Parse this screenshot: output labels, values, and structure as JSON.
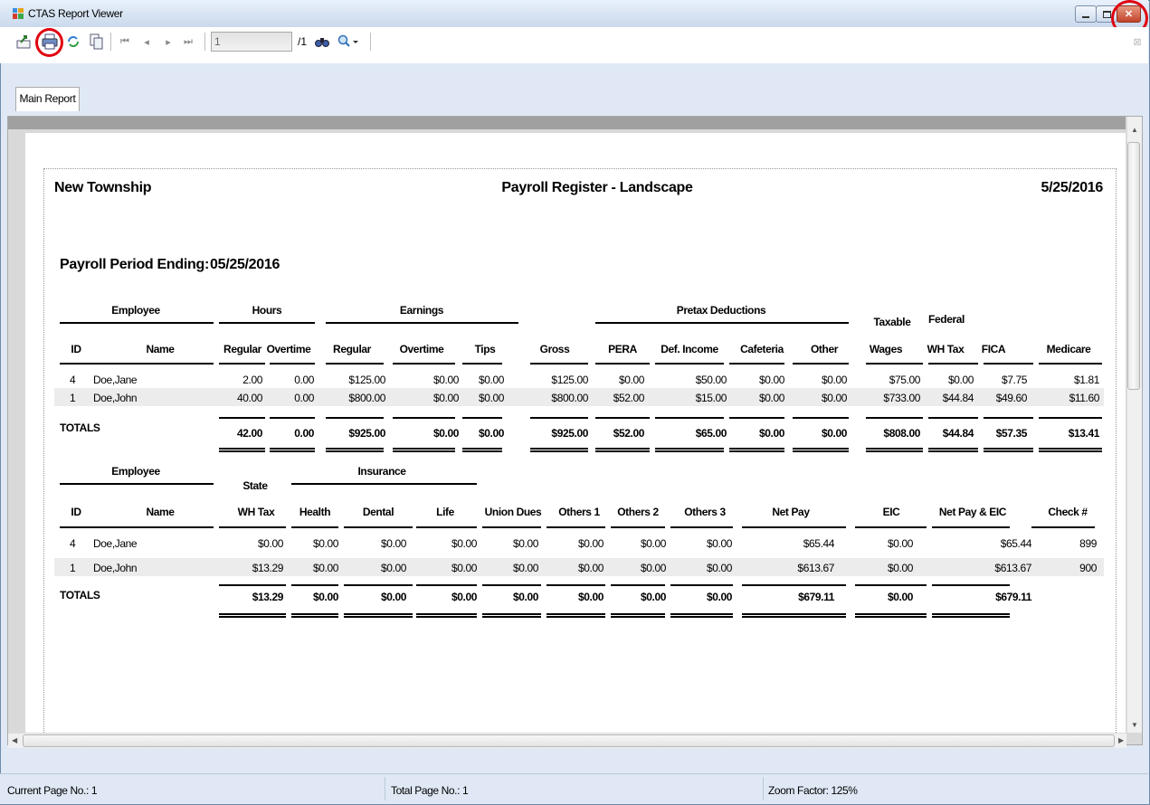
{
  "window": {
    "title": "CTAS Report Viewer"
  },
  "toolbar": {
    "page_input": "1",
    "page_total": "/1"
  },
  "tabs": [
    "Main Report"
  ],
  "report": {
    "organization": "New Township",
    "title": "Payroll Register - Landscape",
    "date": "5/25/2016",
    "period_label": "Payroll Period Ending:",
    "period_value": "05/25/2016",
    "section1": {
      "group_headers": {
        "employee": "Employee",
        "hours": "Hours",
        "earnings": "Earnings",
        "pretax": "Pretax Deductions",
        "taxable": "Taxable",
        "federal": "Federal"
      },
      "columns": [
        "ID",
        "Name",
        "Regular",
        "Overtime",
        "Regular",
        "Overtime",
        "Tips",
        "Gross",
        "PERA",
        "Def. Income",
        "Cafeteria",
        "Other",
        "Wages",
        "WH Tax",
        "FICA",
        "Medicare"
      ],
      "rows": [
        [
          "4",
          "Doe,Jane",
          "2.00",
          "0.00",
          "$125.00",
          "$0.00",
          "$0.00",
          "$125.00",
          "$0.00",
          "$50.00",
          "$0.00",
          "$0.00",
          "$75.00",
          "$0.00",
          "$7.75",
          "$1.81"
        ],
        [
          "1",
          "Doe,John",
          "40.00",
          "0.00",
          "$800.00",
          "$0.00",
          "$0.00",
          "$800.00",
          "$52.00",
          "$15.00",
          "$0.00",
          "$0.00",
          "$733.00",
          "$44.84",
          "$49.60",
          "$11.60"
        ]
      ],
      "totals_label": "TOTALS",
      "totals": [
        "42.00",
        "0.00",
        "$925.00",
        "$0.00",
        "$0.00",
        "$925.00",
        "$52.00",
        "$65.00",
        "$0.00",
        "$0.00",
        "$808.00",
        "$44.84",
        "$57.35",
        "$13.41"
      ]
    },
    "section2": {
      "group_headers": {
        "employee": "Employee",
        "state": "State",
        "insurance": "Insurance"
      },
      "columns": [
        "ID",
        "Name",
        "WH Tax",
        "Health",
        "Dental",
        "Life",
        "Union Dues",
        "Others 1",
        "Others 2",
        "Others 3",
        "Net Pay",
        "EIC",
        "Net Pay & EIC",
        "Check #"
      ],
      "rows": [
        [
          "4",
          "Doe,Jane",
          "$0.00",
          "$0.00",
          "$0.00",
          "$0.00",
          "$0.00",
          "$0.00",
          "$0.00",
          "$0.00",
          "$65.44",
          "$0.00",
          "$65.44",
          "899"
        ],
        [
          "1",
          "Doe,John",
          "$13.29",
          "$0.00",
          "$0.00",
          "$0.00",
          "$0.00",
          "$0.00",
          "$0.00",
          "$0.00",
          "$613.67",
          "$0.00",
          "$613.67",
          "900"
        ]
      ],
      "totals_label": "TOTALS",
      "totals": [
        "$13.29",
        "$0.00",
        "$0.00",
        "$0.00",
        "$0.00",
        "$0.00",
        "$0.00",
        "$0.00",
        "$679.11",
        "$0.00",
        "$679.11"
      ]
    }
  },
  "statusbar": {
    "current_page": "Current Page No.: 1",
    "total_page": "Total Page No.: 1",
    "zoom": "Zoom Factor: 125%"
  },
  "icons": [
    "app-icon",
    "export-icon",
    "print-icon",
    "refresh-icon",
    "toggle-tree-icon",
    "first-page-icon",
    "previous-page-icon",
    "next-page-icon",
    "last-page-icon",
    "find-icon",
    "zoom-icon",
    "close-panel-icon"
  ],
  "highlight_color": "#e0000f"
}
